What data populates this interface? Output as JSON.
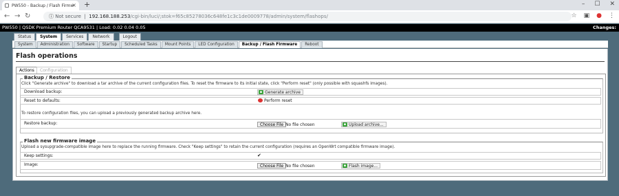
{
  "browser": {
    "tab_title": "PW550 - Backup / Flash Firmw",
    "new_tab": "+",
    "not_secure": "Not secure",
    "host": "192.168.188.253",
    "path": "/cgi-bin/luci/;stok=f65c85278036c648fe1c3c1de0009778/admin/system/flashops/"
  },
  "router": {
    "header_text": "PW550 | QSDK Premium Router QCA9531 | Load: 0.02 0.04 0.05",
    "changes_label": "Changes:"
  },
  "top_tabs": [
    {
      "label": "Status",
      "active": false
    },
    {
      "label": "System",
      "active": true
    },
    {
      "label": "Services",
      "active": false
    },
    {
      "label": "Network",
      "active": false
    },
    {
      "label": "Logout",
      "active": false
    }
  ],
  "sub_tabs": [
    {
      "label": "System",
      "active": false
    },
    {
      "label": "Administration",
      "active": false
    },
    {
      "label": "Software",
      "active": false
    },
    {
      "label": "Startup",
      "active": false
    },
    {
      "label": "Scheduled Tasks",
      "active": false
    },
    {
      "label": "Mount Points",
      "active": false
    },
    {
      "label": "LED Configuration",
      "active": false
    },
    {
      "label": "Backup / Flash Firmware",
      "active": true
    },
    {
      "label": "Reboot",
      "active": false
    }
  ],
  "page": {
    "title": "Flash operations",
    "tab_actions": "Actions",
    "tab_configuration": "Configuration"
  },
  "backup": {
    "legend": "Backup / Restore",
    "description": "Click \"Generate archive\" to download a tar archive of the current configuration files. To reset the firmware to its initial state, click \"Perform reset\" (only possible with squashfs images).",
    "download_label": "Download backup:",
    "generate_button": "Generate archive",
    "reset_label": "Reset to defaults:",
    "reset_button": "Perform reset",
    "restore_description": "To restore configuration files, you can upload a previously generated backup archive here.",
    "restore_label": "Restore backup:",
    "choose_file": "Choose File",
    "no_file": "No file chosen",
    "upload_button": "Upload archive..."
  },
  "flash": {
    "legend": "Flash new firmware image",
    "description": "Upload a sysupgrade-compatible image here to replace the running firmware. Check \"Keep settings\" to retain the current configuration (requires an OpenWrt compatible firmware image).",
    "keep_label": "Keep settings:",
    "keep_checked": true,
    "image_label": "Image:",
    "choose_file": "Choose File",
    "no_file": "No file chosen",
    "flash_button": "Flash image..."
  }
}
